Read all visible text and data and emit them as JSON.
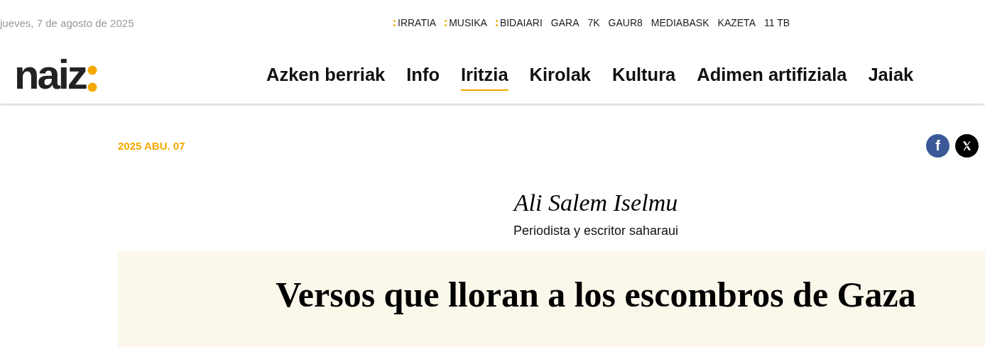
{
  "topbar": {
    "date": "jueves, 7 de agosto de 2025",
    "services": [
      {
        "label": "IRRATIA",
        "marked": true
      },
      {
        "label": "MUSIKA",
        "marked": true
      },
      {
        "label": "BIDAIARI",
        "marked": true
      },
      {
        "label": "GARA",
        "marked": false
      },
      {
        "label": "7K",
        "marked": false
      },
      {
        "label": "GAUR8",
        "marked": false
      },
      {
        "label": "MEDIABASK",
        "marked": false
      },
      {
        "label": "KAZETA",
        "marked": false
      },
      {
        "label": "11 TB",
        "marked": false
      }
    ]
  },
  "header": {
    "logo": "naiz",
    "nav": [
      {
        "label": "Azken berriak",
        "selected": false
      },
      {
        "label": "Info",
        "selected": false
      },
      {
        "label": "Iritzia",
        "selected": true
      },
      {
        "label": "Kirolak",
        "selected": false
      },
      {
        "label": "Kultura",
        "selected": false
      },
      {
        "label": "Adimen artifiziala",
        "selected": false
      },
      {
        "label": "Jaiak",
        "selected": false
      }
    ]
  },
  "article": {
    "date": "2025 ABU. 07",
    "share": [
      {
        "kind": "facebook",
        "label": "f"
      },
      {
        "kind": "x"
      }
    ],
    "author": "Ali Salem Iselmu",
    "author_role": "Periodista y escritor saharaui",
    "title": "Versos que lloran a los escombros de Gaza"
  }
}
